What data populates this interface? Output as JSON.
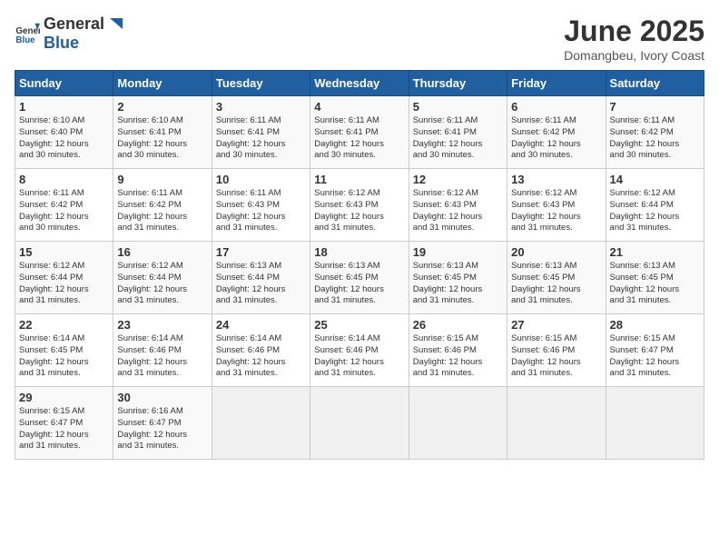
{
  "header": {
    "logo_general": "General",
    "logo_blue": "Blue",
    "month_title": "June 2025",
    "location": "Domangbeu, Ivory Coast"
  },
  "calendar": {
    "weekdays": [
      "Sunday",
      "Monday",
      "Tuesday",
      "Wednesday",
      "Thursday",
      "Friday",
      "Saturday"
    ],
    "weeks": [
      [
        {
          "day": "",
          "empty": true
        },
        {
          "day": "",
          "empty": true
        },
        {
          "day": "",
          "empty": true
        },
        {
          "day": "",
          "empty": true
        },
        {
          "day": "",
          "empty": true
        },
        {
          "day": "",
          "empty": true
        },
        {
          "day": "",
          "empty": true
        }
      ],
      [
        {
          "day": "1",
          "sunrise": "6:10 AM",
          "sunset": "6:40 PM",
          "daylight": "12 hours and 30 minutes."
        },
        {
          "day": "2",
          "sunrise": "6:10 AM",
          "sunset": "6:41 PM",
          "daylight": "12 hours and 30 minutes."
        },
        {
          "day": "3",
          "sunrise": "6:11 AM",
          "sunset": "6:41 PM",
          "daylight": "12 hours and 30 minutes."
        },
        {
          "day": "4",
          "sunrise": "6:11 AM",
          "sunset": "6:41 PM",
          "daylight": "12 hours and 30 minutes."
        },
        {
          "day": "5",
          "sunrise": "6:11 AM",
          "sunset": "6:41 PM",
          "daylight": "12 hours and 30 minutes."
        },
        {
          "day": "6",
          "sunrise": "6:11 AM",
          "sunset": "6:42 PM",
          "daylight": "12 hours and 30 minutes."
        },
        {
          "day": "7",
          "sunrise": "6:11 AM",
          "sunset": "6:42 PM",
          "daylight": "12 hours and 30 minutes."
        }
      ],
      [
        {
          "day": "8",
          "sunrise": "6:11 AM",
          "sunset": "6:42 PM",
          "daylight": "12 hours and 30 minutes."
        },
        {
          "day": "9",
          "sunrise": "6:11 AM",
          "sunset": "6:42 PM",
          "daylight": "12 hours and 31 minutes."
        },
        {
          "day": "10",
          "sunrise": "6:11 AM",
          "sunset": "6:43 PM",
          "daylight": "12 hours and 31 minutes."
        },
        {
          "day": "11",
          "sunrise": "6:12 AM",
          "sunset": "6:43 PM",
          "daylight": "12 hours and 31 minutes."
        },
        {
          "day": "12",
          "sunrise": "6:12 AM",
          "sunset": "6:43 PM",
          "daylight": "12 hours and 31 minutes."
        },
        {
          "day": "13",
          "sunrise": "6:12 AM",
          "sunset": "6:43 PM",
          "daylight": "12 hours and 31 minutes."
        },
        {
          "day": "14",
          "sunrise": "6:12 AM",
          "sunset": "6:44 PM",
          "daylight": "12 hours and 31 minutes."
        }
      ],
      [
        {
          "day": "15",
          "sunrise": "6:12 AM",
          "sunset": "6:44 PM",
          "daylight": "12 hours and 31 minutes."
        },
        {
          "day": "16",
          "sunrise": "6:12 AM",
          "sunset": "6:44 PM",
          "daylight": "12 hours and 31 minutes."
        },
        {
          "day": "17",
          "sunrise": "6:13 AM",
          "sunset": "6:44 PM",
          "daylight": "12 hours and 31 minutes."
        },
        {
          "day": "18",
          "sunrise": "6:13 AM",
          "sunset": "6:45 PM",
          "daylight": "12 hours and 31 minutes."
        },
        {
          "day": "19",
          "sunrise": "6:13 AM",
          "sunset": "6:45 PM",
          "daylight": "12 hours and 31 minutes."
        },
        {
          "day": "20",
          "sunrise": "6:13 AM",
          "sunset": "6:45 PM",
          "daylight": "12 hours and 31 minutes."
        },
        {
          "day": "21",
          "sunrise": "6:13 AM",
          "sunset": "6:45 PM",
          "daylight": "12 hours and 31 minutes."
        }
      ],
      [
        {
          "day": "22",
          "sunrise": "6:14 AM",
          "sunset": "6:45 PM",
          "daylight": "12 hours and 31 minutes."
        },
        {
          "day": "23",
          "sunrise": "6:14 AM",
          "sunset": "6:46 PM",
          "daylight": "12 hours and 31 minutes."
        },
        {
          "day": "24",
          "sunrise": "6:14 AM",
          "sunset": "6:46 PM",
          "daylight": "12 hours and 31 minutes."
        },
        {
          "day": "25",
          "sunrise": "6:14 AM",
          "sunset": "6:46 PM",
          "daylight": "12 hours and 31 minutes."
        },
        {
          "day": "26",
          "sunrise": "6:15 AM",
          "sunset": "6:46 PM",
          "daylight": "12 hours and 31 minutes."
        },
        {
          "day": "27",
          "sunrise": "6:15 AM",
          "sunset": "6:46 PM",
          "daylight": "12 hours and 31 minutes."
        },
        {
          "day": "28",
          "sunrise": "6:15 AM",
          "sunset": "6:47 PM",
          "daylight": "12 hours and 31 minutes."
        }
      ],
      [
        {
          "day": "29",
          "sunrise": "6:15 AM",
          "sunset": "6:47 PM",
          "daylight": "12 hours and 31 minutes."
        },
        {
          "day": "30",
          "sunrise": "6:16 AM",
          "sunset": "6:47 PM",
          "daylight": "12 hours and 31 minutes."
        },
        {
          "day": "",
          "empty": true
        },
        {
          "day": "",
          "empty": true
        },
        {
          "day": "",
          "empty": true
        },
        {
          "day": "",
          "empty": true
        },
        {
          "day": "",
          "empty": true
        }
      ]
    ]
  }
}
